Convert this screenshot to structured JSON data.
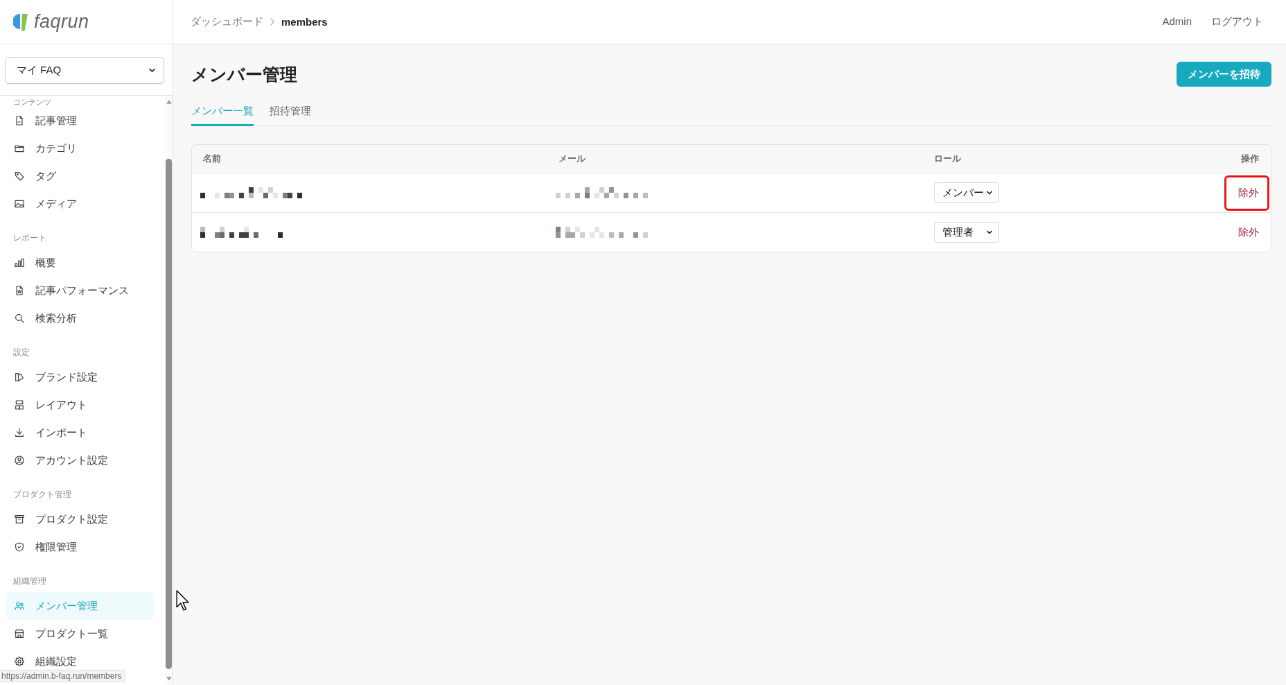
{
  "logo": {
    "text": "faqrun"
  },
  "faq_select": {
    "value": "マイ FAQ"
  },
  "sidebar": {
    "sections": [
      {
        "label": "コンテンツ",
        "items": [
          {
            "label": "記事管理",
            "selected": false
          },
          {
            "label": "カテゴリ",
            "selected": false
          },
          {
            "label": "タグ",
            "selected": false
          },
          {
            "label": "メディア",
            "selected": false
          }
        ]
      },
      {
        "label": "レポート",
        "items": [
          {
            "label": "概要",
            "selected": false
          },
          {
            "label": "記事パフォーマンス",
            "selected": false
          },
          {
            "label": "検索分析",
            "selected": false
          }
        ]
      },
      {
        "label": "設定",
        "items": [
          {
            "label": "ブランド設定",
            "selected": false
          },
          {
            "label": "レイアウト",
            "selected": false
          },
          {
            "label": "インポート",
            "selected": false
          },
          {
            "label": "アカウント設定",
            "selected": false
          }
        ]
      },
      {
        "label": "プロダクト管理",
        "items": [
          {
            "label": "プロダクト設定",
            "selected": false
          },
          {
            "label": "権限管理",
            "selected": false
          }
        ]
      },
      {
        "label": "組織管理",
        "items": [
          {
            "label": "メンバー管理",
            "selected": true
          },
          {
            "label": "プロダクト一覧",
            "selected": false
          },
          {
            "label": "組織設定",
            "selected": false
          }
        ]
      }
    ]
  },
  "breadcrumb": [
    {
      "label": "ダッシュボード",
      "current": false
    },
    {
      "label": "members",
      "current": true
    }
  ],
  "header": {
    "user_label": "Admin",
    "logout_label": "ログアウト"
  },
  "page_title": "メンバー管理",
  "invite_button": "メンバーを招待",
  "tabs": [
    {
      "label": "メンバー一覧",
      "selected": true
    },
    {
      "label": "招待管理",
      "selected": false
    }
  ],
  "table": {
    "columns": [
      "名前",
      "メール",
      "ロール",
      "操作"
    ],
    "rows": [
      {
        "role": "メンバー",
        "action": "除外",
        "highlighted": true
      },
      {
        "role": "管理者",
        "action": "除外",
        "highlighted": false
      }
    ]
  },
  "status_url": "https://admin.b-faq.run/members"
}
